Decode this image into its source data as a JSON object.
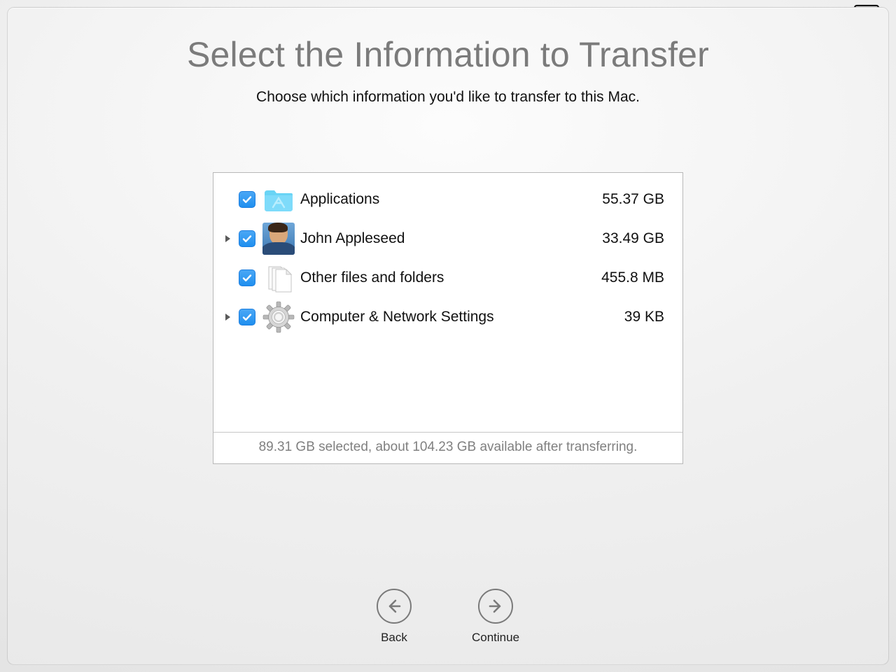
{
  "title": "Select the Information to Transfer",
  "subtitle": "Choose which information you'd like to transfer to this Mac.",
  "items": [
    {
      "label": "Applications",
      "size": "55.37 GB",
      "icon": "applications-folder-icon",
      "expandable": false,
      "checked": true
    },
    {
      "label": "John Appleseed",
      "size": "33.49 GB",
      "icon": "user-avatar-icon",
      "expandable": true,
      "checked": true
    },
    {
      "label": "Other files and folders",
      "size": "455.8 MB",
      "icon": "documents-stack-icon",
      "expandable": false,
      "checked": true
    },
    {
      "label": "Computer & Network Settings",
      "size": "39 KB",
      "icon": "gear-icon",
      "expandable": true,
      "checked": true
    }
  ],
  "status": "89.31 GB selected, about 104.23 GB available after transferring.",
  "nav": {
    "back": "Back",
    "continue": "Continue"
  }
}
